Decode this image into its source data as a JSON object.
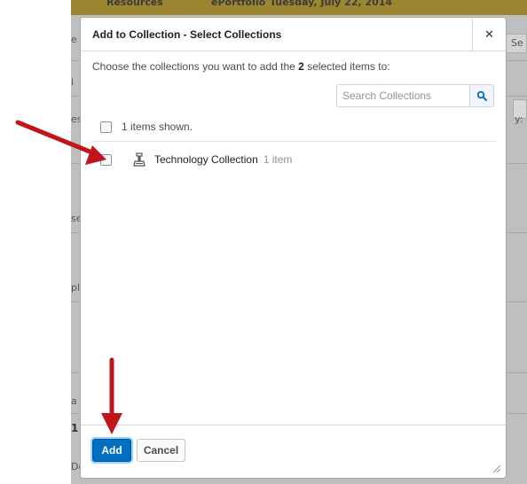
{
  "background": {
    "topbar_items": [
      "Resources",
      "ePortfolio",
      "Tuesday, July 22, 2014"
    ],
    "fragments": [
      "e",
      "Se",
      "i",
      "esc",
      "y:",
      "se",
      "pl",
      "a",
      "1",
      "Do"
    ]
  },
  "dialog": {
    "title": "Add to Collection - Select Collections",
    "close_icon": "close-icon",
    "instruction_prefix": "Choose the collections you want to add the",
    "selected_count": "2",
    "instruction_suffix": "selected items to:",
    "search": {
      "placeholder": "Search Collections",
      "value": "",
      "icon": "search-icon"
    },
    "list": {
      "items_shown_label": "1 items shown.",
      "items": [
        {
          "name": "Technology Collection",
          "count_label": "1 item",
          "icon": "collection-icon",
          "checked": false
        }
      ]
    },
    "footer": {
      "add_label": "Add",
      "cancel_label": "Cancel"
    }
  },
  "colors": {
    "primary_button": "#006fbf",
    "annotation_arrow": "#c0151b",
    "background_overlay": "#bfbfbf",
    "topbar": "#9c8530"
  }
}
